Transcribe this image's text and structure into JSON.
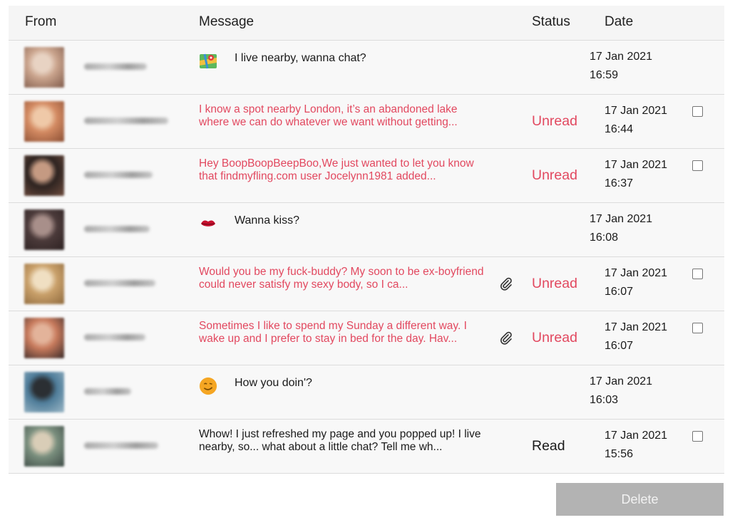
{
  "header": {
    "from": "From",
    "message": "Message",
    "status": "Status",
    "date": "Date"
  },
  "rows": [
    {
      "kind": "short",
      "icon": "map-icon",
      "message": "I live nearby, wanna chat?",
      "status": "",
      "date": "17 Jan 2021",
      "time": "16:59",
      "avatar_colors": [
        "#caa48d",
        "#e8d3c3",
        "#7f5a4a"
      ]
    },
    {
      "kind": "long",
      "message": "I know a spot nearby London, it’s an abandoned lake where we can do whatever we want without getting...",
      "status": "Unread",
      "date": "17 Jan 2021",
      "time": "16:44",
      "attachment": false,
      "avatar_colors": [
        "#d38a62",
        "#efc9a8",
        "#8b4e33"
      ]
    },
    {
      "kind": "long",
      "message": "Hey BoopBoopBeepBoo,We just wanted to let you know that findmyfling.com user Jocelynn1981 added...",
      "status": "Unread",
      "date": "17 Jan 2021",
      "time": "16:37",
      "attachment": false,
      "avatar_colors": [
        "#2d2320",
        "#c59a82",
        "#6d4b3d"
      ]
    },
    {
      "kind": "short",
      "icon": "lips-icon",
      "message": "Wanna kiss?",
      "status": "",
      "date": "17 Jan 2021",
      "time": "16:08",
      "avatar_colors": [
        "#4b3a3a",
        "#a88f8a",
        "#2d2222"
      ]
    },
    {
      "kind": "long",
      "message": "Would you be my fuck-buddy? My soon to be ex-boyfriend could never satisfy my sexy body, so I ca...",
      "status": "Unread",
      "date": "17 Jan 2021",
      "time": "16:07",
      "attachment": true,
      "avatar_colors": [
        "#c9a06a",
        "#f0dfc2",
        "#8f6a3e"
      ]
    },
    {
      "kind": "long",
      "message": "Sometimes I like to spend my Sunday a different way. I wake up and I prefer to stay in bed for the day. Hav...",
      "status": "Unread",
      "date": "17 Jan 2021",
      "time": "16:07",
      "attachment": true,
      "avatar_colors": [
        "#c77a5c",
        "#e3b39a",
        "#3a2a28"
      ]
    },
    {
      "kind": "short",
      "icon": "smiley-icon",
      "message": "How you doin'?",
      "status": "",
      "date": "17 Jan 2021",
      "time": "16:03",
      "avatar_colors": [
        "#4f7d9a",
        "#2b2f33",
        "#9bb7c6"
      ]
    },
    {
      "kind": "long",
      "message": "Whow! I just refreshed my page and you popped up! I live nearby, so... what about a little chat? Tell me wh...",
      "status": "Read",
      "date": "17 Jan 2021",
      "time": "15:56",
      "attachment": false,
      "avatar_colors": [
        "#7a8f7e",
        "#d9cdb7",
        "#3d4a45"
      ]
    }
  ],
  "delete_label": "Delete",
  "colors": {
    "unread": "#e2485f",
    "header_bg": "#f5f5f5",
    "row_bg": "#f8f8f8",
    "delete_bg": "#b3b3b3"
  }
}
